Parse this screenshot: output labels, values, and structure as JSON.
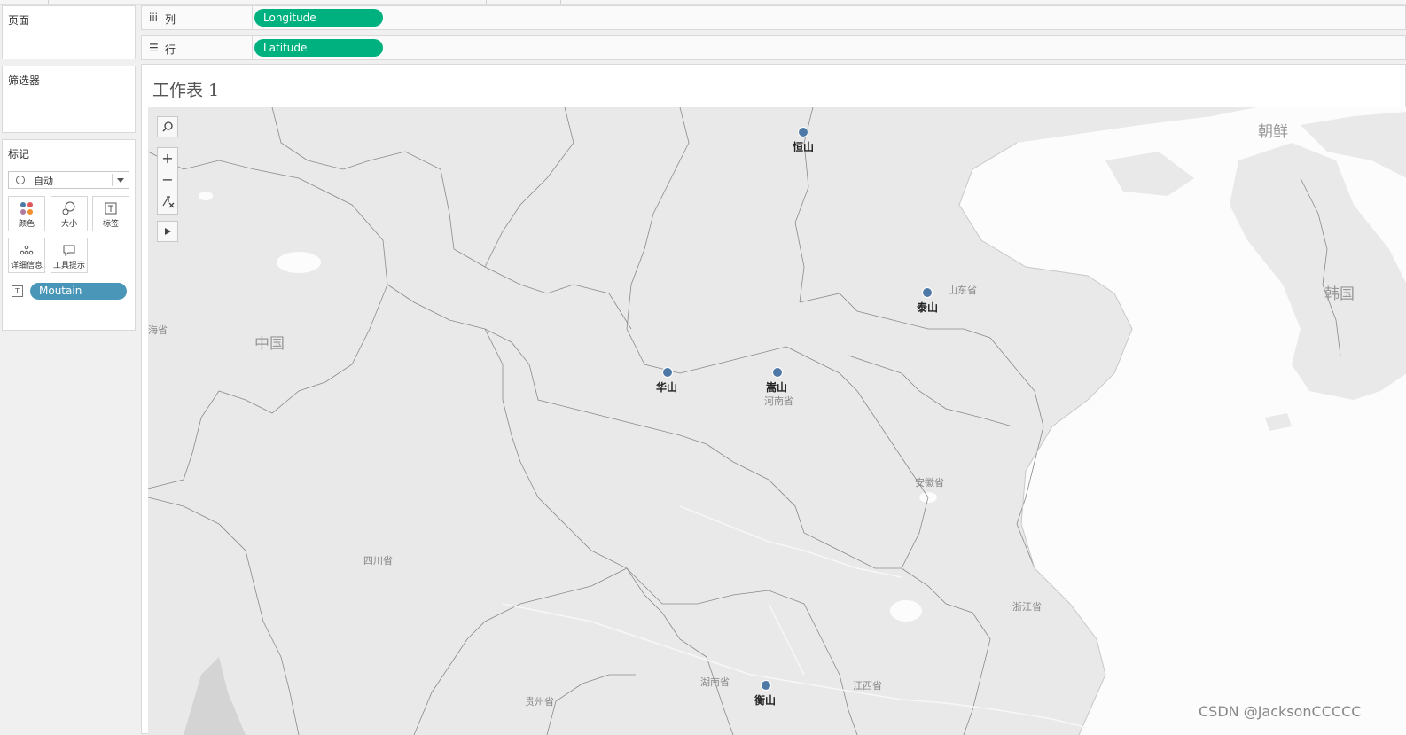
{
  "panes": {
    "pages_title": "页面",
    "filters_title": "筛选器",
    "marks_title": "标记"
  },
  "marks": {
    "type_label": "自动",
    "buttons": [
      {
        "label": "颜色",
        "icon": "color-dots-icon"
      },
      {
        "label": "大小",
        "icon": "size-icon"
      },
      {
        "label": "标签",
        "icon": "label-icon"
      },
      {
        "label": "详细信息",
        "icon": "detail-icon"
      },
      {
        "label": "工具提示",
        "icon": "tooltip-icon"
      }
    ],
    "field_pill": "Moutain"
  },
  "shelves": {
    "columns": {
      "label": "列",
      "pill": "Longitude"
    },
    "rows": {
      "label": "行",
      "pill": "Latitude"
    }
  },
  "worksheet": {
    "title": "工作表 1"
  },
  "map": {
    "mountains": [
      {
        "name": "恒山"
      },
      {
        "name": "泰山"
      },
      {
        "name": "华山"
      },
      {
        "name": "嵩山"
      },
      {
        "name": "衡山"
      }
    ],
    "regions": {
      "shandong": "山东省",
      "henan": "河南省",
      "anhui": "安徽省",
      "sichuan": "四川省",
      "zhejiang": "浙江省",
      "hunan": "湖南省",
      "jiangxi": "江西省",
      "guizhou": "贵州省",
      "qinghai_partial": "海省"
    },
    "countries": {
      "china": "中国",
      "korea_north": "朝鲜",
      "korea_south": "韩国"
    },
    "mark_color": "#4e79a7"
  },
  "watermark": "CSDN @JacksonCCCCC"
}
